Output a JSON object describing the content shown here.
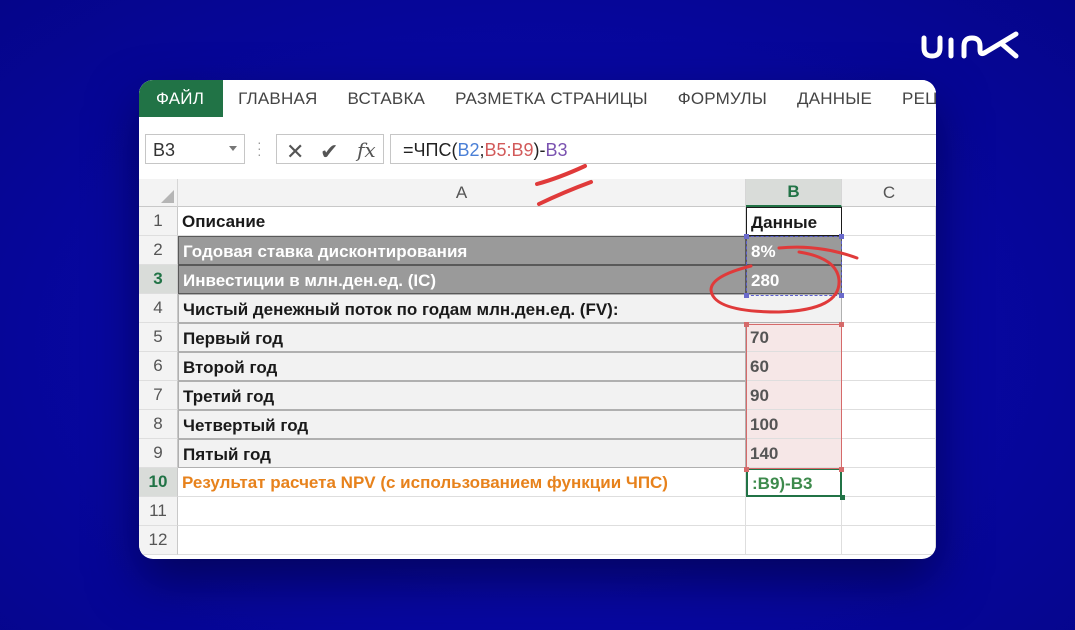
{
  "brand": {
    "logo_text": "uin",
    "logo_icon": "brand-logo"
  },
  "ribbon": {
    "tabs": [
      "ФАЙЛ",
      "ГЛАВНАЯ",
      "ВСТАВКА",
      "РАЗМЕТКА СТРАНИЦЫ",
      "ФОРМУЛЫ",
      "ДАННЫЕ",
      "РЕЦЕ"
    ],
    "active": "ФАЙЛ"
  },
  "formula_bar": {
    "name_box": "B3",
    "cancel_icon": "close-icon",
    "enter_icon": "check-icon",
    "fx_label": "fx",
    "formula_parts": {
      "p1": "=ЧПС(",
      "p2": "B2",
      "p3": ";",
      "p4": "B5:B9",
      "p5": ")-",
      "p6": "B3"
    }
  },
  "columns": {
    "a": "A",
    "b": "B",
    "c": "C"
  },
  "rows": [
    {
      "num": "1",
      "a": "Описание",
      "b": "Данные"
    },
    {
      "num": "2",
      "a": "Годовая ставка дисконтирования",
      "b": "8%"
    },
    {
      "num": "3",
      "a": "Инвестиции в млн.ден.ед. (IC)",
      "b": "280"
    },
    {
      "num": "4",
      "a": "Чистый денежный поток по годам млн.ден.ед. (FV):",
      "b": ""
    },
    {
      "num": "5",
      "a": "Первый год",
      "b": "70"
    },
    {
      "num": "6",
      "a": "Второй год",
      "b": "60"
    },
    {
      "num": "7",
      "a": "Третий год",
      "b": "90"
    },
    {
      "num": "8",
      "a": "Четвертый год",
      "b": "100"
    },
    {
      "num": "9",
      "a": "Пятый год",
      "b": "140"
    },
    {
      "num": "10",
      "a": "Результат расчета NPV (с использованием функции ЧПС)",
      "b": ":B9)-B3"
    },
    {
      "num": "11",
      "a": "",
      "b": ""
    },
    {
      "num": "12",
      "a": "",
      "b": ""
    }
  ],
  "colors": {
    "background": "#0a0aa8",
    "excel_green": "#217346",
    "result_orange": "#e7821c",
    "annotation_red": "#e03a3a"
  }
}
